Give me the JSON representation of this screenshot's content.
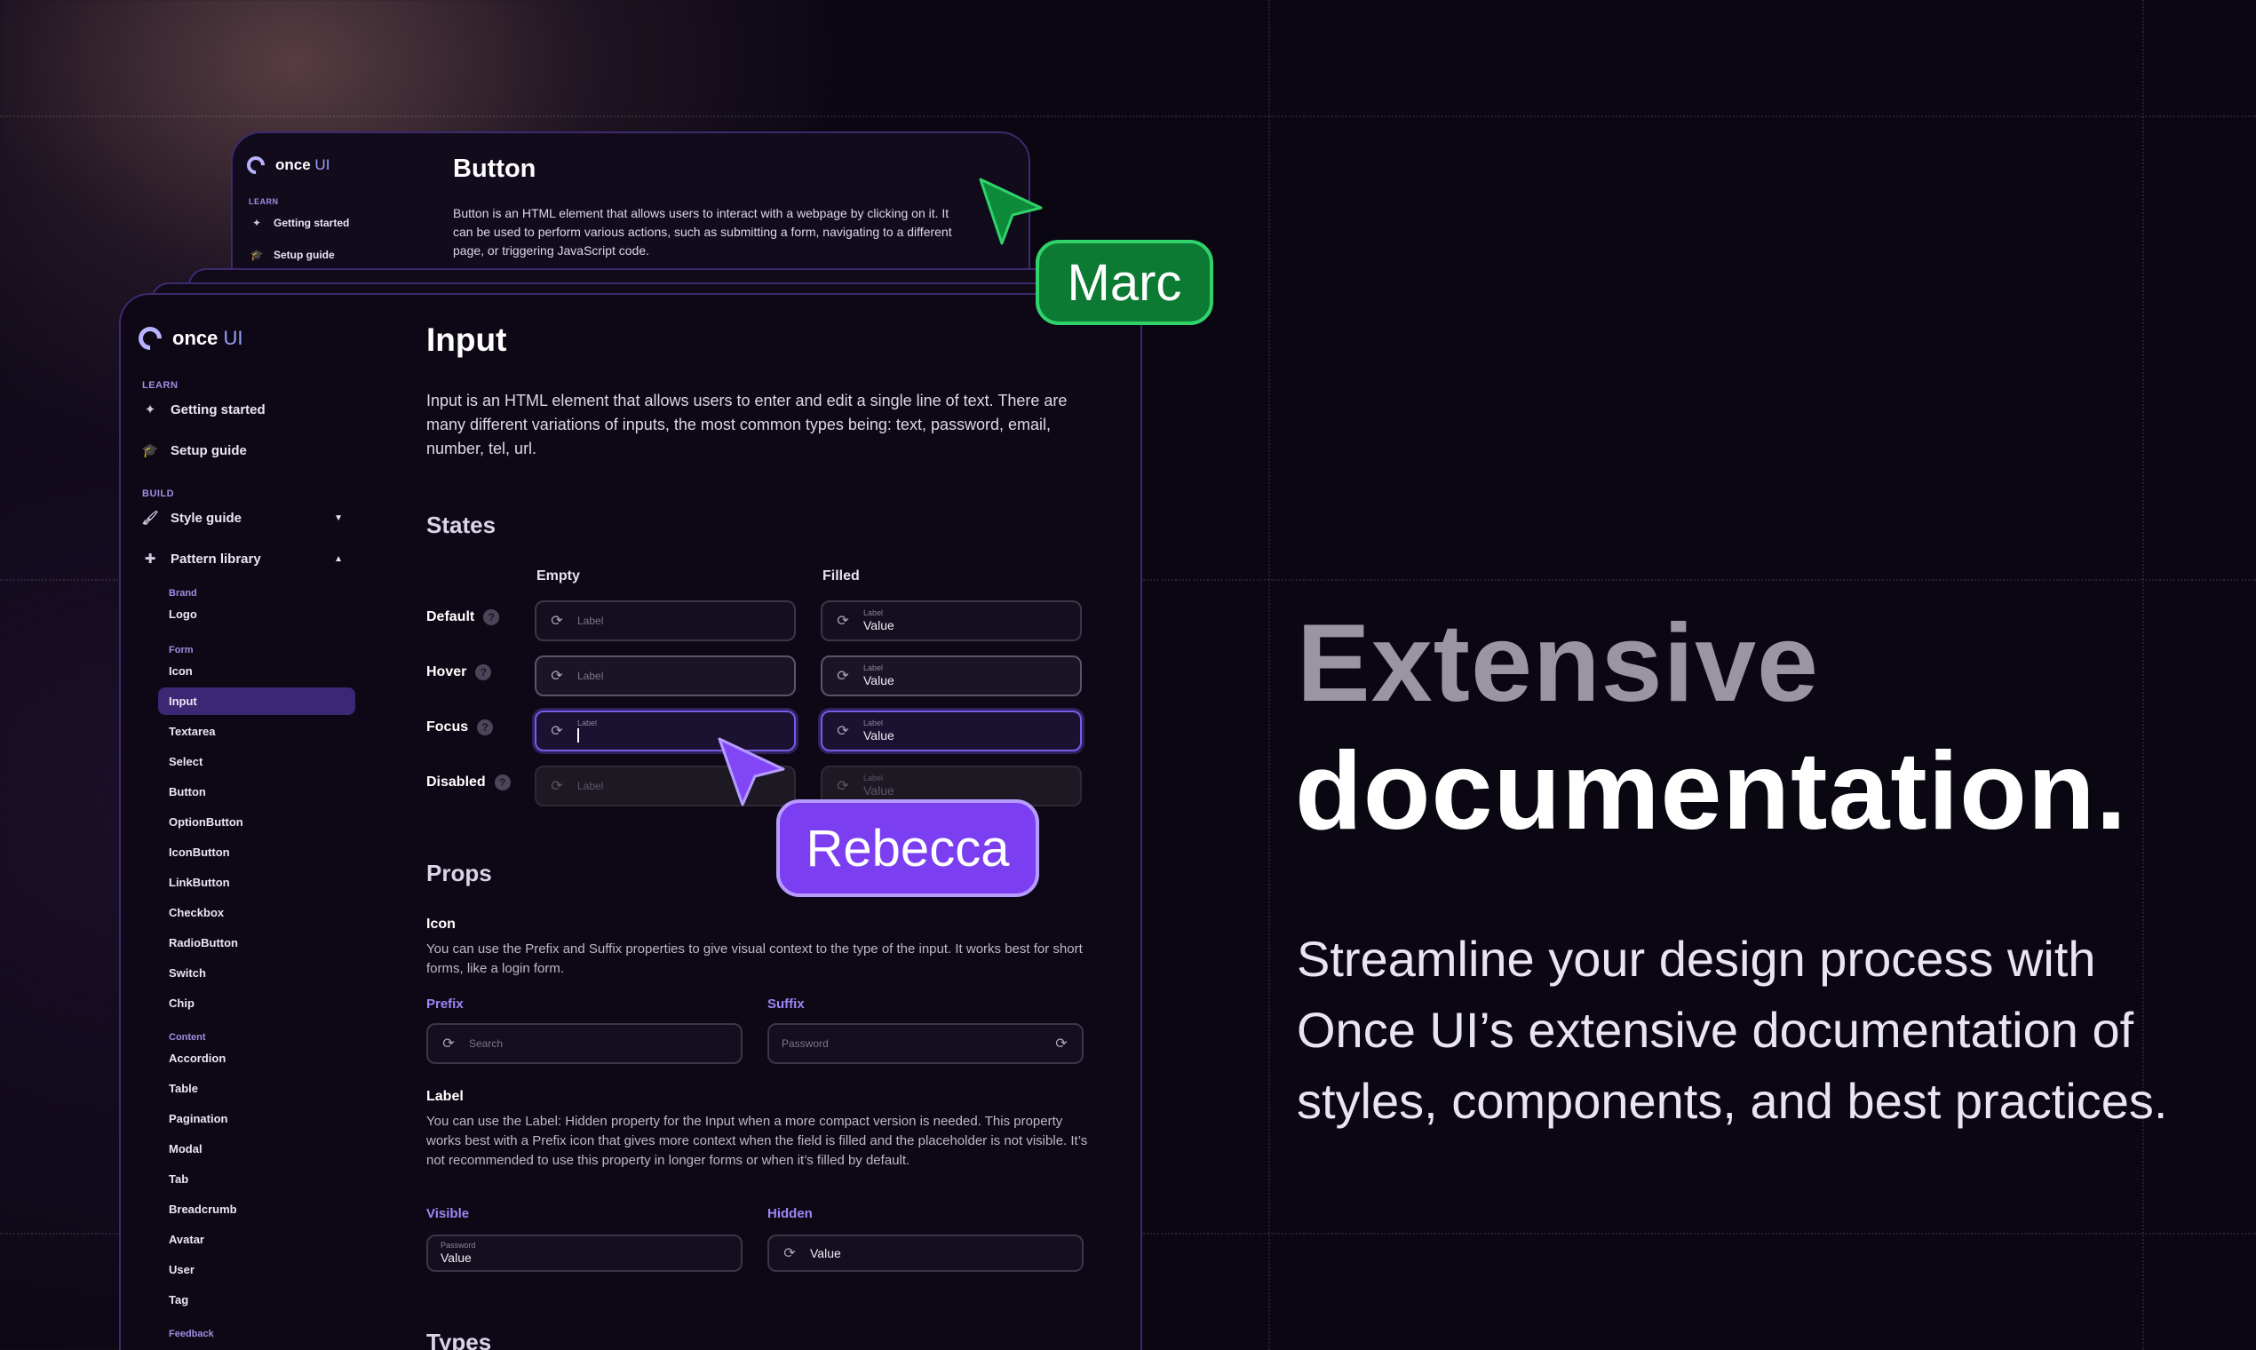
{
  "hero": {
    "line1": "Extensive",
    "line2": "documentation.",
    "subtitle": "Streamline your design process with Once UI’s extensive documentation of styles, components, and best practices."
  },
  "brand": {
    "name": "once",
    "suffix": "UI"
  },
  "back_card": {
    "title": "Button",
    "description": "Button is an HTML element that allows users to interact with a webpage by clicking on it. It can be used to perform various actions, such as submitting a form, navigating to a different page, or triggering JavaScript code.",
    "section_learn": "LEARN",
    "nav": [
      "Getting started",
      "Setup guide"
    ]
  },
  "sidebar": {
    "section_learn": "LEARN",
    "learn_items": [
      "Getting started",
      "Setup guide"
    ],
    "section_build": "BUILD",
    "build_items": [
      "Style guide",
      "Pattern library"
    ],
    "brand_label": "Brand",
    "brand_items": [
      "Logo"
    ],
    "form_label": "Form",
    "form_items": [
      "Icon",
      "Input",
      "Textarea",
      "Select",
      "Button",
      "OptionButton",
      "IconButton",
      "LinkButton",
      "Checkbox",
      "RadioButton",
      "Switch",
      "Chip"
    ],
    "content_label": "Content",
    "content_items": [
      "Accordion",
      "Table",
      "Pagination",
      "Modal",
      "Tab",
      "Breadcrumb",
      "Avatar",
      "User",
      "Tag"
    ],
    "feedback_label": "Feedback"
  },
  "main": {
    "title": "Input",
    "description": "Input is an HTML element that allows users to enter and edit a single line of text. There are many different variations of inputs, the most common types being: text, password, email, number, tel, url.",
    "states_heading": "States",
    "col_empty": "Empty",
    "col_filled": "Filled",
    "rows": [
      "Default",
      "Hover",
      "Focus",
      "Disabled"
    ],
    "field_label": "Label",
    "field_value": "Value",
    "props_heading": "Props",
    "icon_title": "Icon",
    "icon_desc": "You can use the Prefix and Suffix properties to give visual context to the type of the input. It works best for short forms, like a login form.",
    "prefix_label": "Prefix",
    "suffix_label": "Suffix",
    "prefix_placeholder": "Search",
    "suffix_placeholder": "Password",
    "label_title": "Label",
    "label_desc": "You can use the Label: Hidden property for the Input when a more compact version is needed. This property works best with a Prefix icon that gives more context when the field is filled and the placeholder is not visible. It’s not recommended to use this property in longer forms or when it’s filled by default.",
    "visible_label": "Visible",
    "hidden_label": "Hidden",
    "visible_field_label": "Password",
    "visible_field_value": "Value",
    "hidden_field_value": "Value",
    "types_heading": "Types"
  },
  "cursors": {
    "marc": {
      "name": "Marc",
      "color": "#0d7a34"
    },
    "rebecca": {
      "name": "Rebecca",
      "color": "#7b3ef0"
    }
  },
  "icons": {
    "refresh": "refresh-icon",
    "help": "help-icon"
  }
}
